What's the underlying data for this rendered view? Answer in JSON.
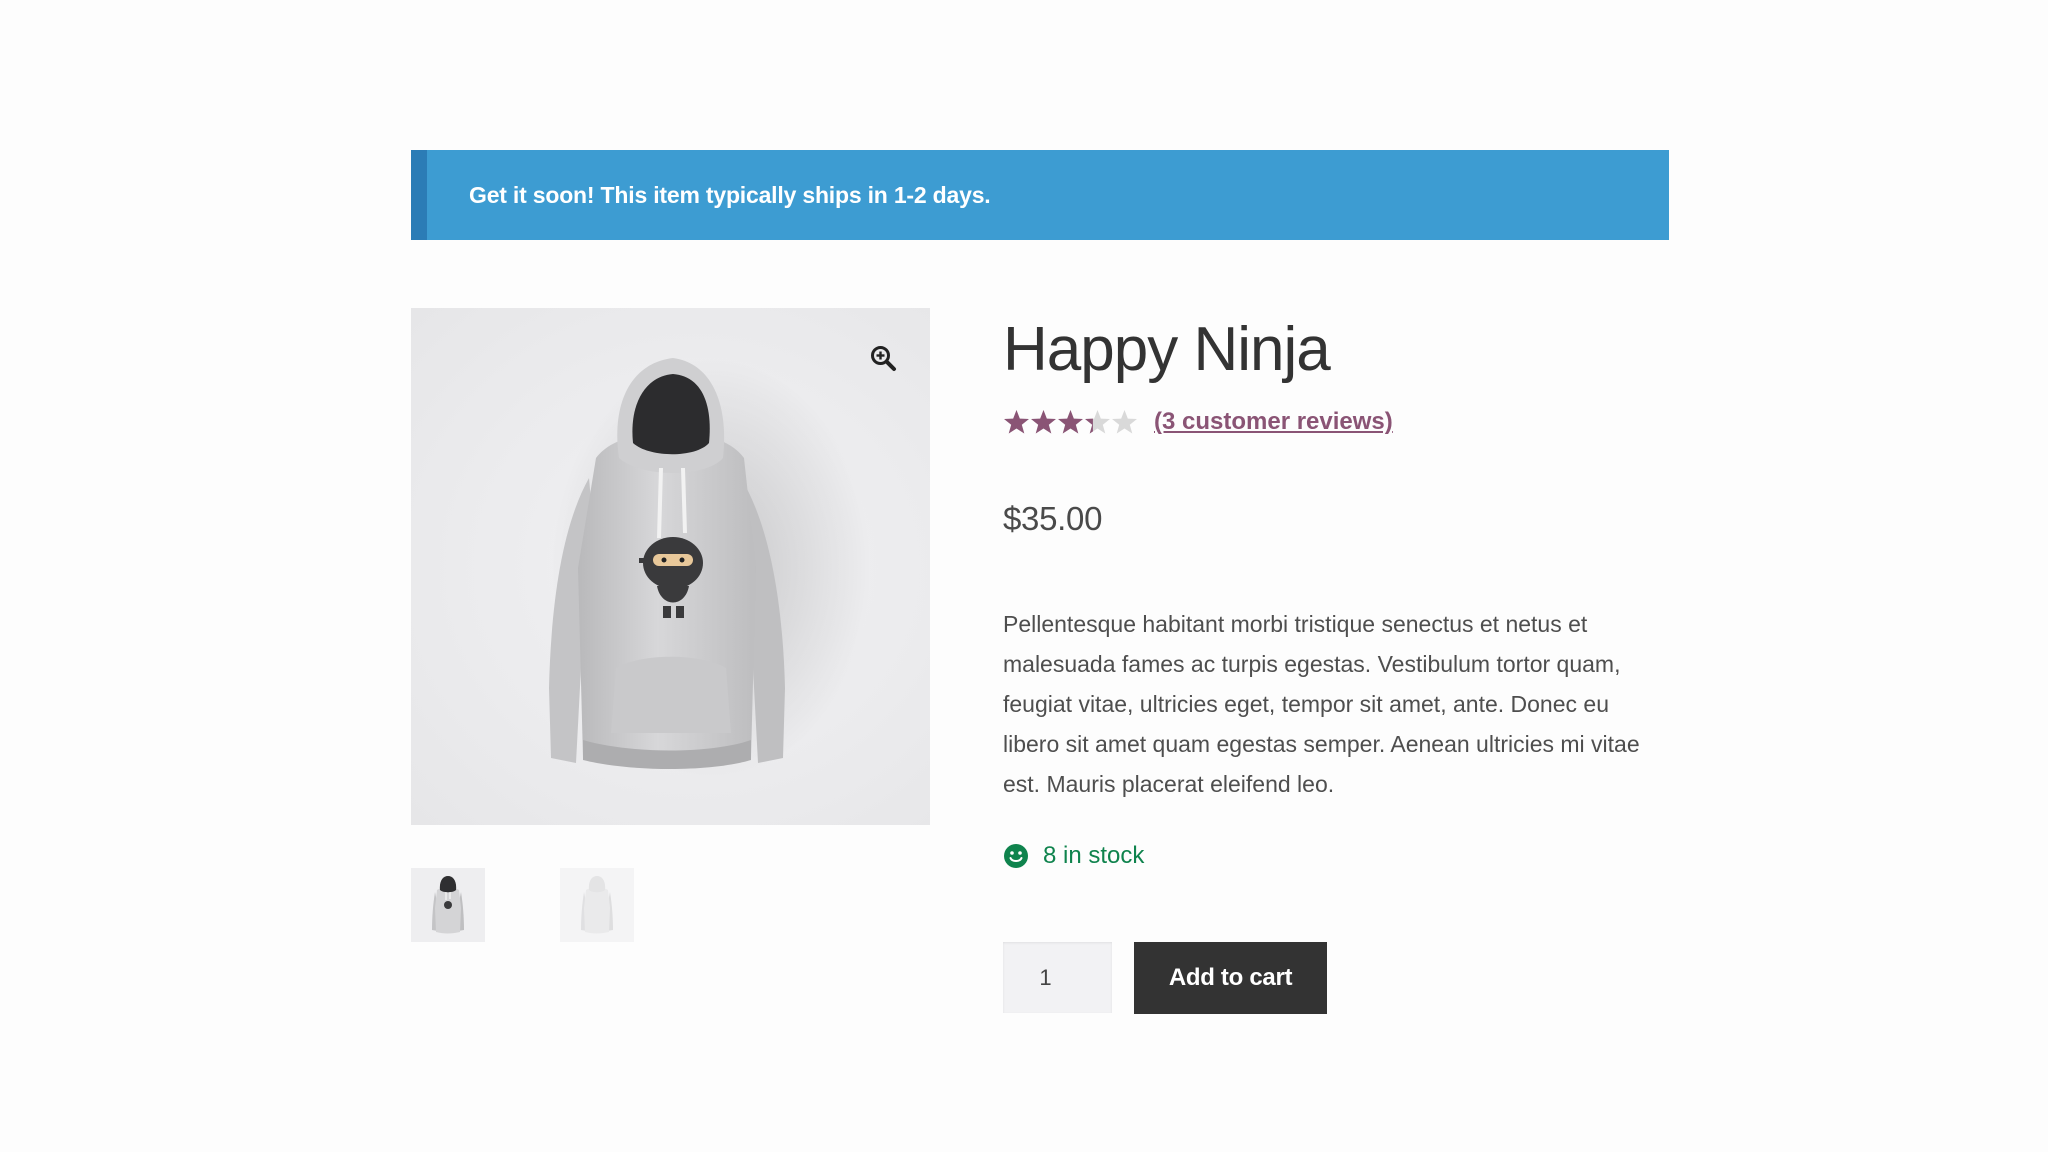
{
  "notice": {
    "message": "Get it soon! This item typically ships in 1-2 days."
  },
  "product": {
    "title": "Happy Ninja",
    "rating": {
      "value": 3.33,
      "max": 5,
      "reviews_link": "(3 customer reviews)"
    },
    "price": "$35.00",
    "description": "Pellentesque habitant morbi tristique senectus et netus et malesuada fames ac turpis egestas. Vestibulum tortor quam, feugiat vitae, ultricies eget, tempor sit amet, ante. Donec eu libero sit amet quam egestas semper. Aenean ultricies mi vitae est. Mauris placerat eleifend leo.",
    "stock": {
      "text": "8 in stock",
      "icon": "smiley-icon"
    },
    "quantity": {
      "value": "1"
    },
    "add_to_cart_label": "Add to cart"
  },
  "gallery": {
    "zoom_icon": "zoom-in-icon",
    "thumbnails": [
      "hoodie-black-hood",
      "hoodie-grey"
    ]
  },
  "colors": {
    "notice_bg": "#3d9cd2",
    "notice_border": "#2b7cb6",
    "star_filled": "#8a5475",
    "star_empty": "#d9d9d9",
    "review_link": "#8a5475",
    "stock_green": "#0f834d",
    "button_bg": "#333333"
  }
}
